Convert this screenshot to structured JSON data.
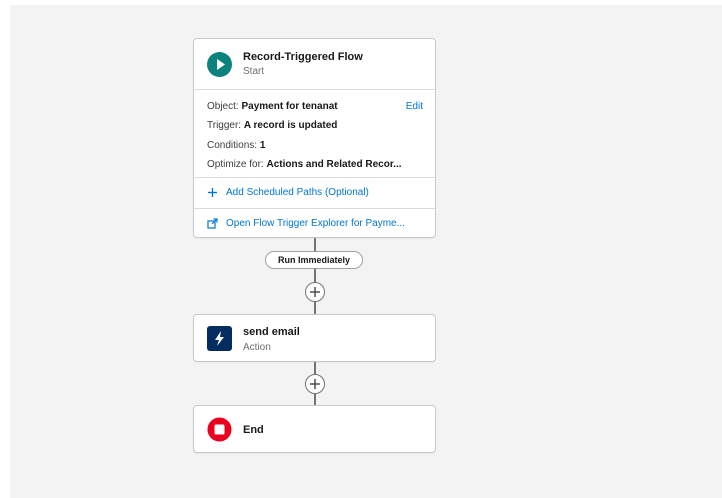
{
  "start_node": {
    "title": "Record-Triggered Flow",
    "subtitle": "Start",
    "edit_label": "Edit",
    "details": [
      {
        "label": "Object: ",
        "value": "Payment for tenanat"
      },
      {
        "label": "Trigger: ",
        "value": "A record is updated"
      },
      {
        "label": "Conditions: ",
        "value": "1"
      },
      {
        "label": "Optimize for: ",
        "value": "Actions and Related Recor..."
      }
    ],
    "add_scheduled_paths": "Add Scheduled Paths (Optional)",
    "open_trigger_explorer": "Open Flow Trigger Explorer for Payme..."
  },
  "path_label": "Run Immediately",
  "action_node": {
    "title": "send email",
    "subtitle": "Action"
  },
  "end_node": {
    "title": "End"
  },
  "colors": {
    "start_icon": "#0b827c",
    "action_icon": "#032d60",
    "end_icon": "#ea001e",
    "link": "#0176d3"
  }
}
